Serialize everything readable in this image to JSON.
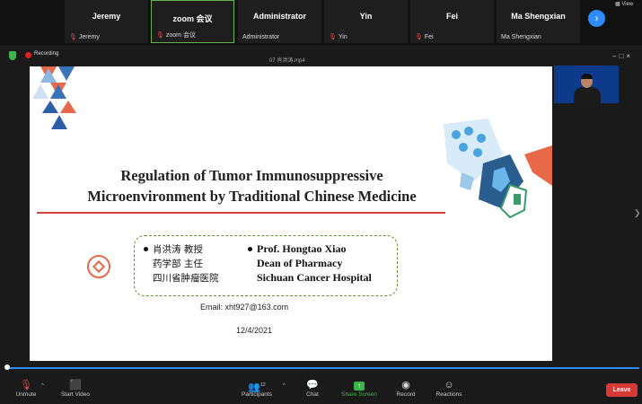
{
  "participants": [
    {
      "name": "Jeremy",
      "label": "Jeremy",
      "muted": true
    },
    {
      "name": "zoom 会议",
      "label": "zoom 会议",
      "muted": true
    },
    {
      "name": "Administrator",
      "label": "Administrator",
      "muted": false
    },
    {
      "name": "Yin",
      "label": "Yin",
      "muted": true
    },
    {
      "name": "Fei",
      "label": "Fei",
      "muted": true
    },
    {
      "name": "Ma Shengxian",
      "label": "Ma Shengxian",
      "muted": false
    }
  ],
  "view_label": "View",
  "status": {
    "recording_label": "Recording",
    "file_name": "07 肖洪涛.mp4"
  },
  "slide": {
    "title_line1": "Regulation of Tumor Immunosuppressive",
    "title_line2": "Microenvironment by Traditional Chinese Medicine",
    "cn_line1": "肖洪涛 教授",
    "cn_line2": "药学部 主任",
    "cn_line3": "四川省肿瘤医院",
    "en_line1": "Prof. Hongtao Xiao",
    "en_line2": "Dean of Pharmacy",
    "en_line3": "Sichuan Cancer Hospital",
    "email": "Email:  xht927@163.com",
    "date": "12/4/2021"
  },
  "toolbar": {
    "unmute": "Unmute",
    "start_video": "Start Video",
    "participants": "Participants",
    "participants_count": "12",
    "chat": "Chat",
    "share_screen": "Share Screen",
    "record": "Record",
    "reactions": "Reactions",
    "leave": "Leave"
  },
  "colors": {
    "accent_blue": "#2d8cff",
    "leave_red": "#d63a36",
    "share_green": "#39b54a",
    "slide_red_line": "#d9433f"
  }
}
